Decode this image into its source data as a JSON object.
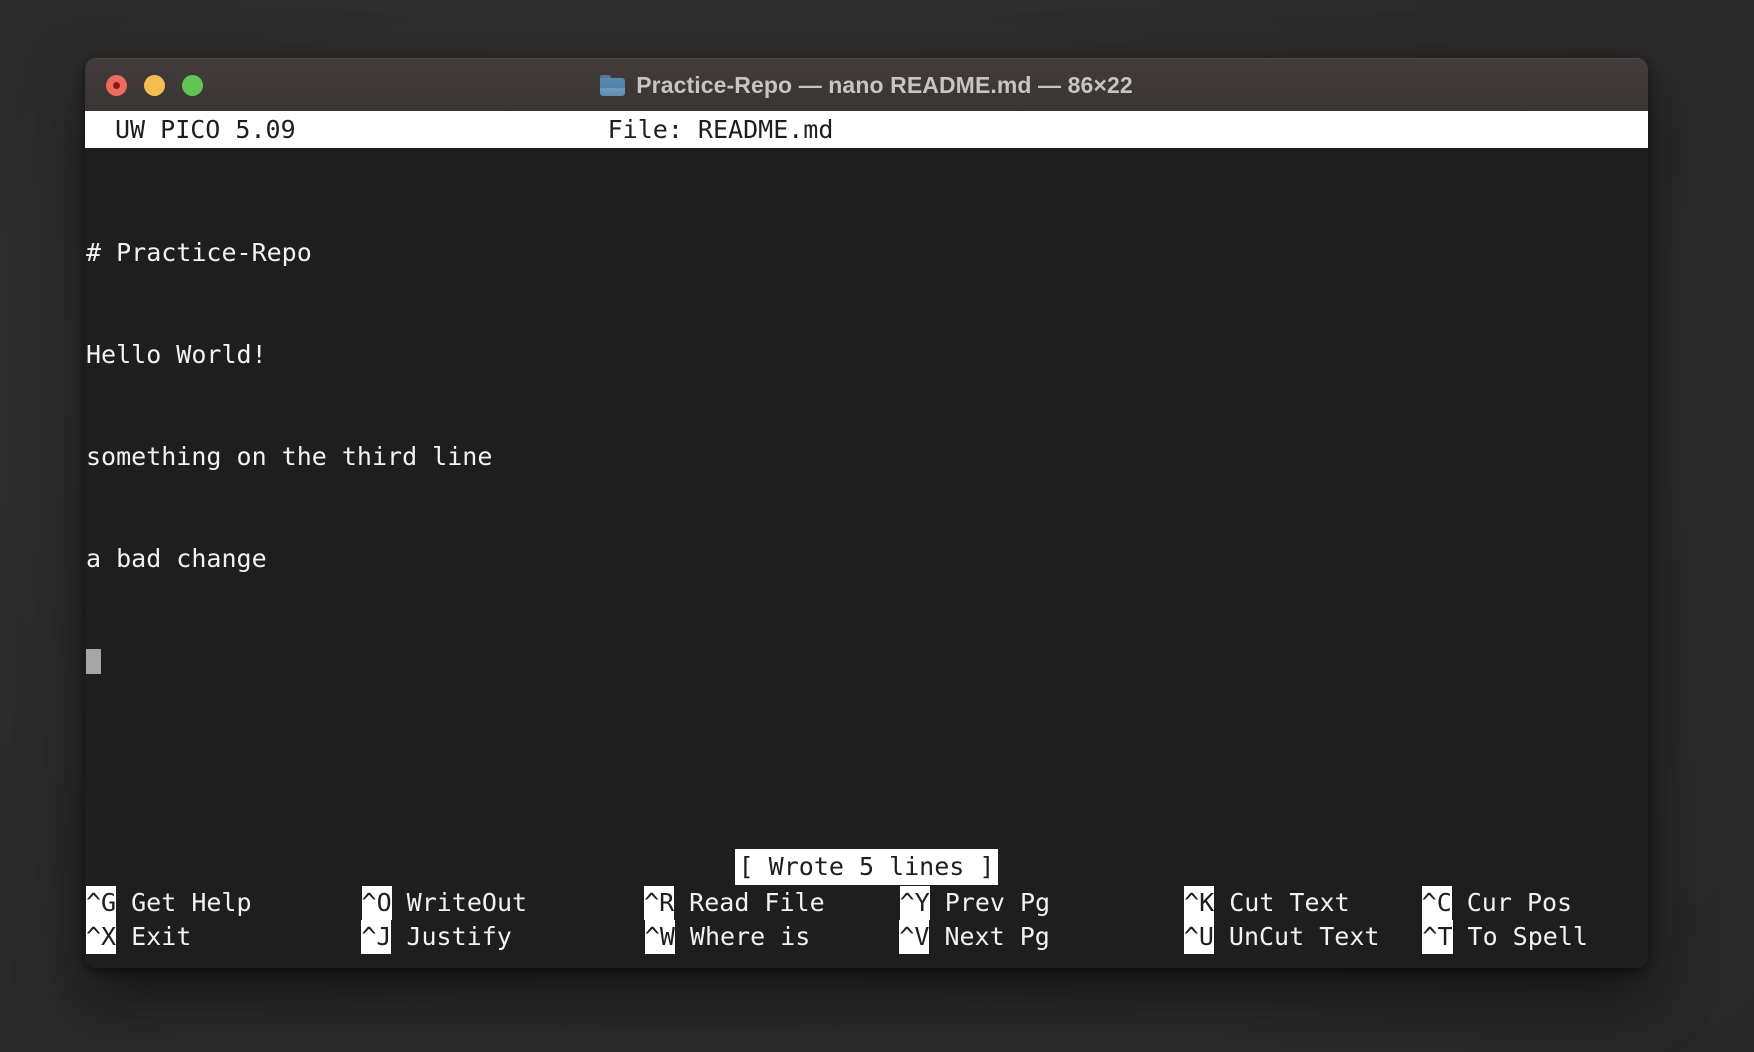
{
  "window": {
    "title": "Practice-Repo — nano README.md — 86×22",
    "folder_icon": "folder-icon",
    "controls": {
      "close": "close-button",
      "minimize": "minimize-button",
      "zoom": "zoom-button"
    }
  },
  "nano": {
    "header": {
      "version": "UW PICO 5.09",
      "file": "File: README.md"
    },
    "buffer": {
      "lines": [
        "# Practice-Repo",
        "Hello World!",
        "something on the third line",
        "a bad change"
      ],
      "cursor_line": 5,
      "cursor_col": 1
    },
    "status_message": "[ Wrote 5 lines ]",
    "shortcuts": [
      [
        {
          "key": "^G",
          "label": "Get Help",
          "pad": 110
        },
        {
          "key": "^O",
          "label": "WriteOut",
          "pad": 117
        },
        {
          "key": "^R",
          "label": "Read File",
          "pad": 75
        },
        {
          "key": "^Y",
          "label": "Prev Pg",
          "pad": 134
        },
        {
          "key": "^K",
          "label": "Cut Text",
          "pad": 72
        },
        {
          "key": "^C",
          "label": "Cur Pos",
          "pad": 0
        }
      ],
      [
        {
          "key": "^X",
          "label": "Exit",
          "pad": 170
        },
        {
          "key": "^J",
          "label": "Justify",
          "pad": 133
        },
        {
          "key": "^W",
          "label": "Where is",
          "pad": 89
        },
        {
          "key": "^V",
          "label": "Next Pg",
          "pad": 134
        },
        {
          "key": "^U",
          "label": "UnCut Text",
          "pad": 43
        },
        {
          "key": "^T",
          "label": "To Spell",
          "pad": 0
        }
      ]
    ]
  },
  "colors": {
    "desktop": "#2c2c2c",
    "titlebar": "#3d3837",
    "terminal_bg": "#1e1e1e",
    "terminal_fg": "#f2f2f2",
    "inverse_bg": "#ffffff",
    "inverse_fg": "#1e1e1e",
    "cursor": "#a6a6a6",
    "close": "#ed6a5e",
    "minimize": "#f5bd4f",
    "zoom": "#61c554"
  }
}
